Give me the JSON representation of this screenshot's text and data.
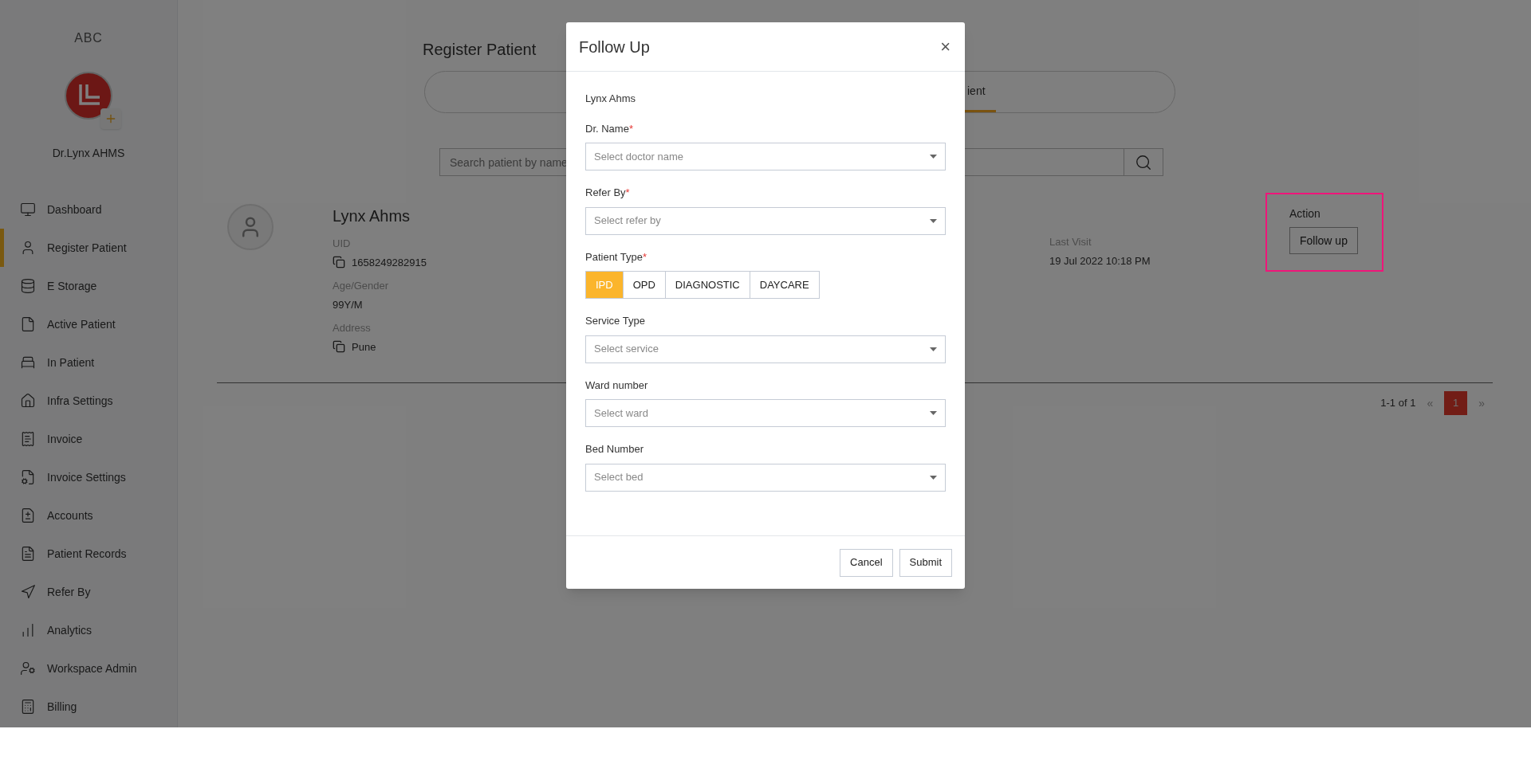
{
  "sidebar": {
    "brand": "ABC",
    "profile_name": "Dr.Lynx AHMS",
    "items": [
      {
        "label": "Dashboard",
        "selected": false
      },
      {
        "label": "Register Patient",
        "selected": true
      },
      {
        "label": "E Storage",
        "selected": false
      },
      {
        "label": "Active Patient",
        "selected": false
      },
      {
        "label": "In Patient",
        "selected": false
      },
      {
        "label": "Infra Settings",
        "selected": false
      },
      {
        "label": "Invoice",
        "selected": false
      },
      {
        "label": "Invoice Settings",
        "selected": false
      },
      {
        "label": "Accounts",
        "selected": false
      },
      {
        "label": "Patient Records",
        "selected": false
      },
      {
        "label": "Refer By",
        "selected": false
      },
      {
        "label": "Analytics",
        "selected": false
      },
      {
        "label": "Workspace Admin",
        "selected": false
      },
      {
        "label": "Billing",
        "selected": false
      }
    ]
  },
  "main": {
    "title": "Register Patient",
    "tabs": [
      {
        "label": "ient",
        "selected": true
      }
    ],
    "search": {
      "placeholder": "Search patient by name"
    },
    "patient": {
      "name": "Lynx Ahms",
      "details": [
        {
          "label": "UID",
          "value": "1658249282915",
          "kind": "copy"
        },
        {
          "label": "Age/Gender",
          "value": "99Y/M",
          "kind": "plain"
        },
        {
          "label": "Address",
          "value": "Pune",
          "kind": "copy"
        }
      ],
      "last_visit": {
        "label": "Last Visit",
        "value": "19 Jul 2022 10:18 PM"
      },
      "action": {
        "heading": "Action",
        "button": "Follow up",
        "highlighted": true
      }
    },
    "pagination": {
      "range": "1-1 of 1",
      "prev": "«",
      "pages": [
        {
          "label": "1",
          "selected": true
        }
      ],
      "next": "»"
    }
  },
  "dialog": {
    "title": "Follow Up",
    "close": "×",
    "patient_name": "Lynx Ahms",
    "fields": [
      {
        "kind": "select",
        "label": "Dr. Name",
        "asterisk": "*",
        "placeholder": "Select doctor name"
      },
      {
        "kind": "select",
        "label": "Refer By",
        "asterisk": "*",
        "placeholder": "Select refer by"
      },
      {
        "kind": "segmented",
        "label": "Patient Type",
        "asterisk": "*",
        "options": [
          {
            "label": "IPD",
            "selected": true
          },
          {
            "label": "OPD",
            "selected": false
          },
          {
            "label": "DIAGNOSTIC",
            "selected": false
          },
          {
            "label": "DAYCARE",
            "selected": false
          }
        ]
      },
      {
        "kind": "select",
        "label": "Service Type",
        "placeholder": "Select service"
      },
      {
        "kind": "select",
        "label": "Ward number",
        "placeholder": "Select ward"
      },
      {
        "kind": "select",
        "label": "Bed Number",
        "placeholder": "Select bed"
      }
    ],
    "buttons": [
      "Cancel",
      "Submit"
    ]
  }
}
